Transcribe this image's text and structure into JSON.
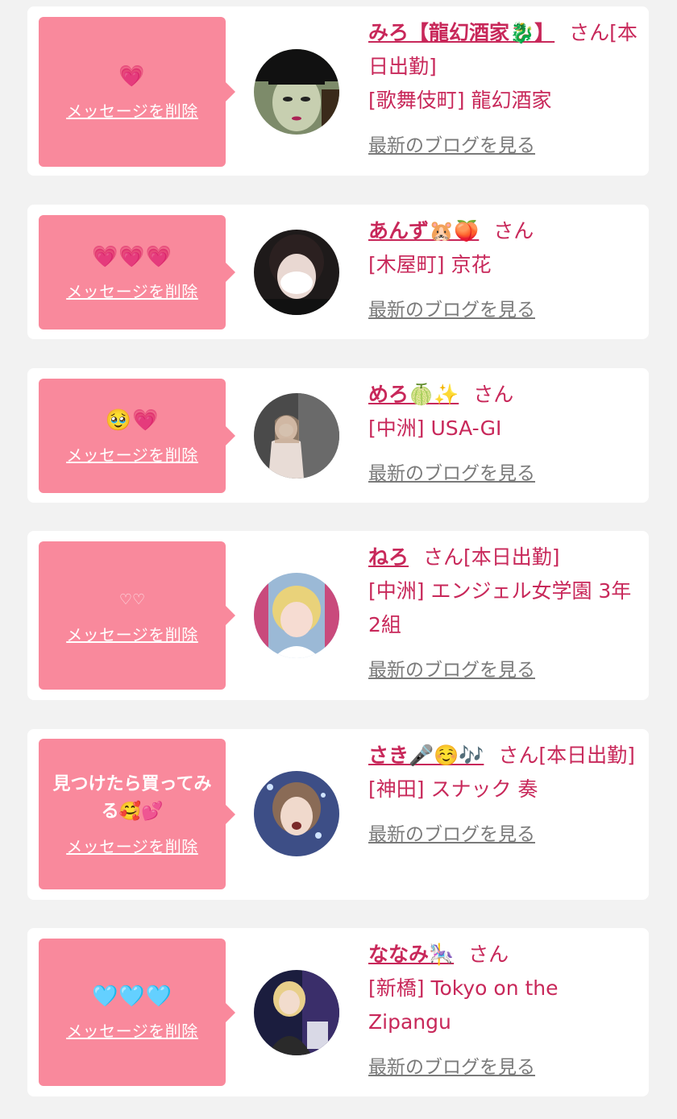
{
  "colors": {
    "accent": "#c8285a",
    "bubble": "#f9899c",
    "background": "#f2f2f2",
    "link_gray": "#7a7a7a"
  },
  "delete_label": "メッセージを削除",
  "blog_label": "最新のブログを見る",
  "san_label": "さん",
  "items": [
    {
      "message": "💗",
      "name": "みろ【龍幻酒家🐉】",
      "status": "[本日出勤]",
      "shop": "[歌舞伎町] 龍幻酒家"
    },
    {
      "message": "💗💗💗",
      "name": "あんず🐹🍑",
      "status": "",
      "shop": "[木屋町] 京花"
    },
    {
      "message": "🥹💗",
      "name": "めろ🍈✨",
      "status": "",
      "shop": "[中洲] USA-GI"
    },
    {
      "message": "♡♡",
      "name": "ねろ",
      "status": "[本日出勤]",
      "shop": "[中洲] エンジェル女学園 3年2組"
    },
    {
      "message": "見つけたら買ってみる🥰💕",
      "name": "さき🎤☺️🎶",
      "status": "[本日出勤]",
      "shop": "[神田] スナック 奏"
    },
    {
      "message": "🩵🩵🩵",
      "name": "ななみ🎠",
      "status": "",
      "shop": "[新橋] Tokyo on the Zipangu"
    }
  ]
}
